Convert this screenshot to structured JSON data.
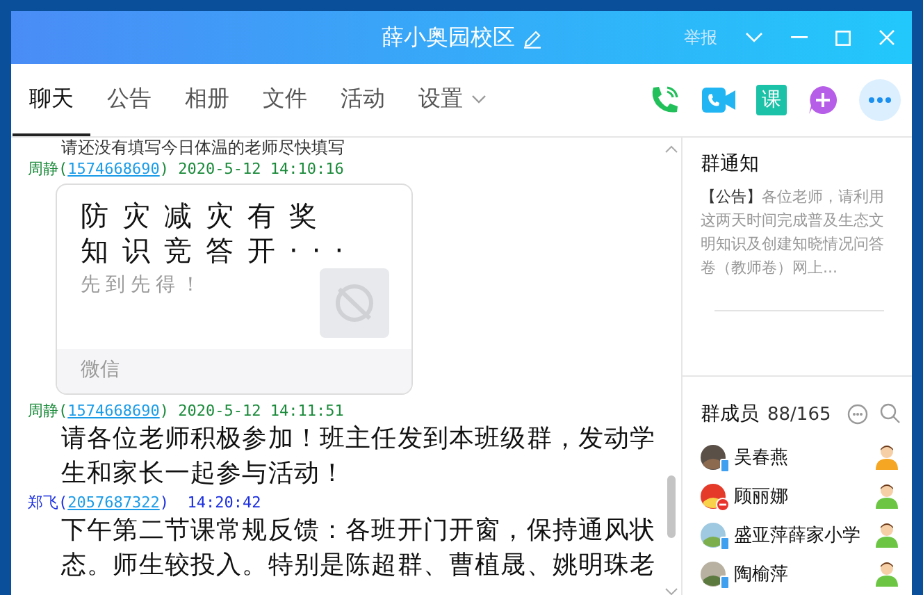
{
  "window": {
    "title": "薛小奥园校区",
    "report": "举报"
  },
  "tabs": [
    {
      "label": "聊天",
      "selected": true
    },
    {
      "label": "公告",
      "selected": false
    },
    {
      "label": "相册",
      "selected": false
    },
    {
      "label": "文件",
      "selected": false
    },
    {
      "label": "活动",
      "selected": false
    },
    {
      "label": "设置",
      "selected": false,
      "dropdown": true
    }
  ],
  "toolbar": {
    "course_label": "课"
  },
  "messages": [
    {
      "kind": "text",
      "text": "请还没有填写今日体温的老师尽快填写"
    },
    {
      "kind": "header",
      "sender": "周静(",
      "color": "#1a8a3a",
      "id": "1574668690",
      "time": ") 2020-5-12 14:10:16"
    },
    {
      "kind": "card",
      "title": "防灾减灾有奖知识竞答开···",
      "subtitle": "先到先得！",
      "source": "微信"
    },
    {
      "kind": "header",
      "sender": "周静(",
      "color": "#1a8a3a",
      "id": "1574668690",
      "time": ") 2020-5-12 14:11:51"
    },
    {
      "kind": "text",
      "text": "请各位老师积极参加！班主任发到本班级群，发动学生和家长一起参与活动！"
    },
    {
      "kind": "header",
      "sender": "郑飞(",
      "color": "#1a2ee0",
      "id": "2057687322",
      "time": ")  14:20:42"
    },
    {
      "kind": "text",
      "text": "下午第二节课常规反馈：各班开门开窗，保持通风状态。师生较投入。特别是陈超群、曹植晟、姚明珠老"
    }
  ],
  "notice": {
    "title": "群通知",
    "tag": "【公告】",
    "text": "各位老师，请利用这两天时间完成普及生态文明知识及创建知晓情况问答卷（教师卷）网上..."
  },
  "members": {
    "title": "群成员",
    "count": "88/165",
    "items": [
      {
        "name": "吴春燕",
        "kind": "mobile",
        "color": "#f5a623"
      },
      {
        "name": "顾丽娜",
        "kind": "busy",
        "color": "#6cc644"
      },
      {
        "name": "盛亚萍薛家小学",
        "kind": "mobile",
        "color": "#6cc644"
      },
      {
        "name": "陶榆萍",
        "kind": "mobile",
        "color": "#6cc644"
      }
    ]
  }
}
